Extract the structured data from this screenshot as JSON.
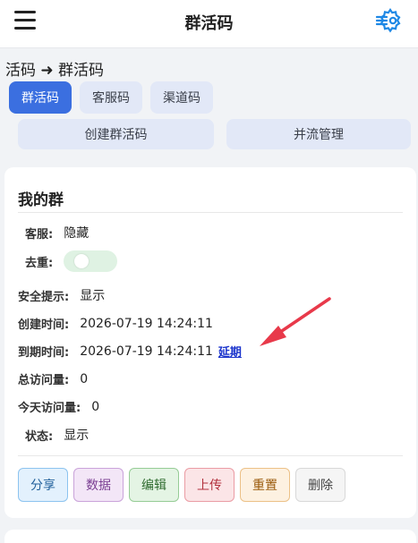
{
  "header": {
    "title": "群活码",
    "menu_icon": "hamburger-icon",
    "settings_icon": "gear-icon"
  },
  "breadcrumb": "活码 ➜ 群活码",
  "tabs": [
    {
      "label": "群活码",
      "active": true
    },
    {
      "label": "客服码",
      "active": false
    },
    {
      "label": "渠道码",
      "active": false
    }
  ],
  "actions": {
    "create_label": "创建群活码",
    "merge_label": "并流管理"
  },
  "card": {
    "title": "我的群",
    "fields": {
      "service_label": "客服:",
      "service_value": "隐藏",
      "dedupe_label": "去重:",
      "dedupe_on": false,
      "safety_label": "安全提示:",
      "safety_value": "显示",
      "created_label": "创建时间:",
      "created_value": "2026-07-19 14:24:11",
      "expire_label": "到期时间:",
      "expire_value": "2026-07-19 14:24:11",
      "extend_label": "延期",
      "total_label": "总访问量:",
      "total_value": "0",
      "today_label": "今天访问量:",
      "today_value": "0",
      "status_label": "状态:",
      "status_value": "显示"
    },
    "buttons": {
      "share": "分享",
      "data": "数据",
      "edit": "编辑",
      "upload": "上传",
      "reset": "重置",
      "delete": "删除"
    }
  },
  "colors": {
    "primary": "#3b6fe0",
    "annotation_arrow": "#e8394a",
    "link": "#1a33cc"
  }
}
